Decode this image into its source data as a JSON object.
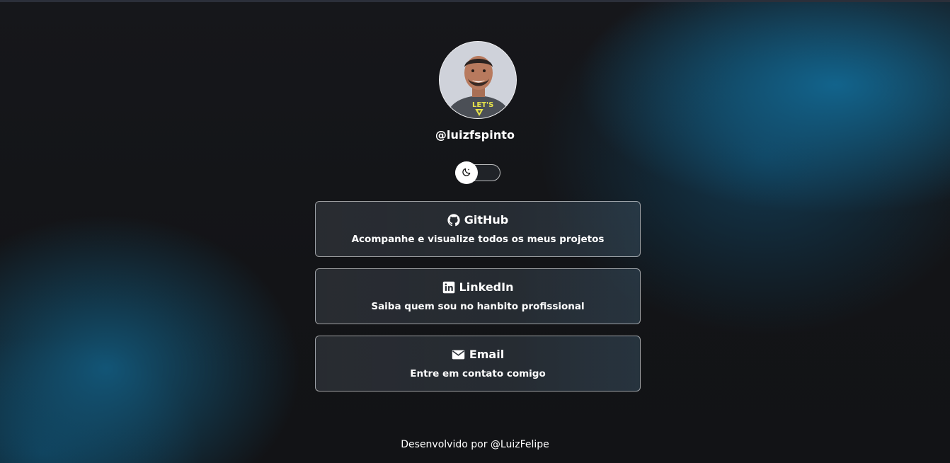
{
  "profile": {
    "username": "@luizfspinto"
  },
  "theme_toggle": {
    "icon": "moon-icon"
  },
  "links": [
    {
      "icon": "github-icon",
      "title": "GitHub",
      "subtitle": "Acompanhe e visualize todos os meus projetos"
    },
    {
      "icon": "linkedin-icon",
      "title": "LinkedIn",
      "subtitle": "Saiba quem sou no hanbito profissional"
    },
    {
      "icon": "mail-icon",
      "title": "Email",
      "subtitle": "Entre em contato comigo"
    }
  ],
  "footer": {
    "text": "Desenvolvido por @LuizFelipe"
  },
  "colors": {
    "background": "#131417",
    "accent_glow": "#126e9b"
  }
}
